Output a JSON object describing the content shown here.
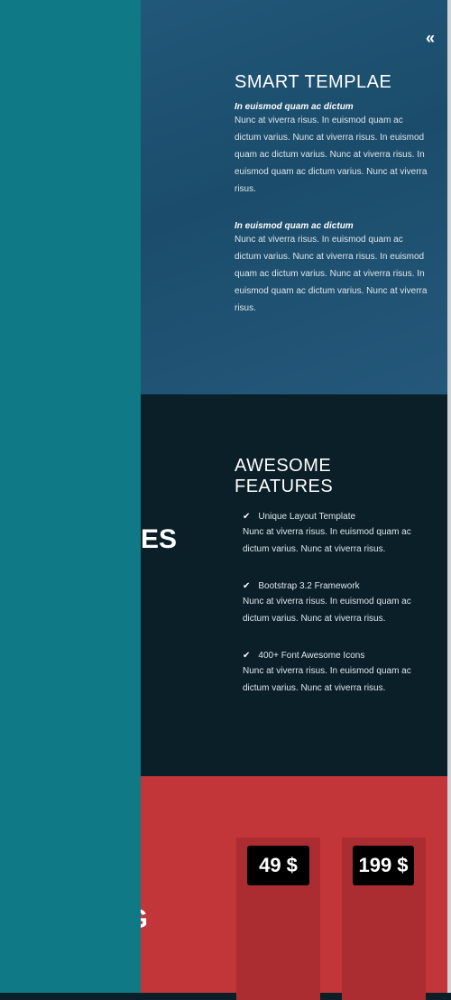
{
  "nav": {
    "collapse_icon": "double-chevron-left"
  },
  "smart": {
    "title": "SMART TEMPLAE",
    "blocks": [
      {
        "subtitle": "In euismod quam ac dictum",
        "text": "Nunc at viverra risus. In euismod quam ac dictum varius. Nunc at viverra risus. In euismod quam ac dictum varius. Nunc at viverra risus. In euismod quam ac dictum varius. Nunc at viverra risus."
      },
      {
        "subtitle": "In euismod quam ac dictum",
        "text": "Nunc at viverra risus. In euismod quam ac dictum varius. Nunc at viverra risus. In euismod quam ac dictum varius. Nunc at viverra risus. In euismod quam ac dictum varius. Nunc at viverra risus."
      }
    ]
  },
  "features": {
    "side_heading": "ES",
    "title": "AWESOME FEATURES",
    "items": [
      {
        "title": "Unique Layout Template",
        "text": "Nunc at viverra risus. In euismod quam ac dictum varius. Nunc at viverra risus."
      },
      {
        "title": "Bootstrap 3.2 Framework",
        "text": "Nunc at viverra risus. In euismod quam ac dictum varius. Nunc at viverra risus."
      },
      {
        "title": "400+ Font Awesome Icons",
        "text": "Nunc at viverra risus. In euismod quam ac dictum varius. Nunc at viverra risus."
      }
    ]
  },
  "pricing": {
    "side_heading": "G",
    "plans": [
      {
        "price": "49 $"
      },
      {
        "price": "199 $"
      }
    ]
  },
  "colors": {
    "panel": "#0f7986",
    "features_bg": "#0a1f28",
    "pricing_bg": "#c2363a"
  }
}
